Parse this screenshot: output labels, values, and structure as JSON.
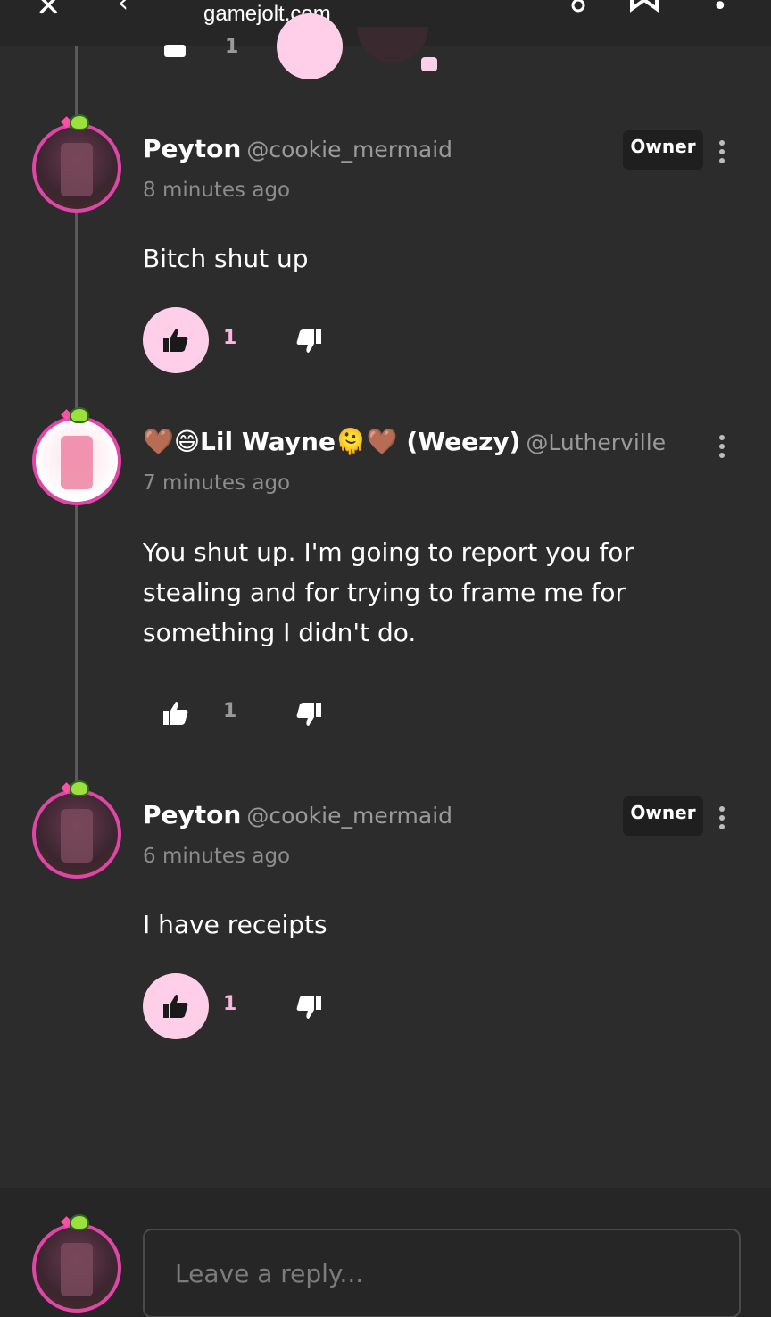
{
  "browser": {
    "url": "gamejolt.com"
  },
  "comments": [
    {
      "author_name": "Peyton",
      "author_handle": "@cookie_mermaid",
      "timestamp": "8 minutes ago",
      "badge": "Owner",
      "body": "Bitch shut up",
      "likes": "1",
      "liked": true
    },
    {
      "author_name": "🤎😄Lil Wayne🫠🤎 (Weezy)",
      "author_handle": "@Lutherville",
      "timestamp": "7 minutes ago",
      "body": "You shut up. I'm going to report you for stealing and for trying to frame me for something I didn't do.",
      "likes": "1",
      "liked": false
    },
    {
      "author_name": "Peyton",
      "author_handle": "@cookie_mermaid",
      "timestamp": "6 minutes ago",
      "badge": "Owner",
      "body": "I have receipts",
      "likes": "1",
      "liked": true
    }
  ],
  "previous_row": {
    "likes": "1"
  },
  "reply": {
    "placeholder": "Leave a reply..."
  },
  "colors": {
    "background": "#2c2c2c",
    "accent_pink": "#ffcfe9",
    "avatar_ring": "#e045a8",
    "muted_text": "#8c8c8c"
  },
  "icons": [
    "close-icon",
    "back-arrow-icon",
    "share-icon",
    "bookmark-icon",
    "more-vert-icon",
    "thumbs-up-icon",
    "thumbs-down-icon",
    "kebab-menu-icon",
    "frog-badge-icon"
  ]
}
